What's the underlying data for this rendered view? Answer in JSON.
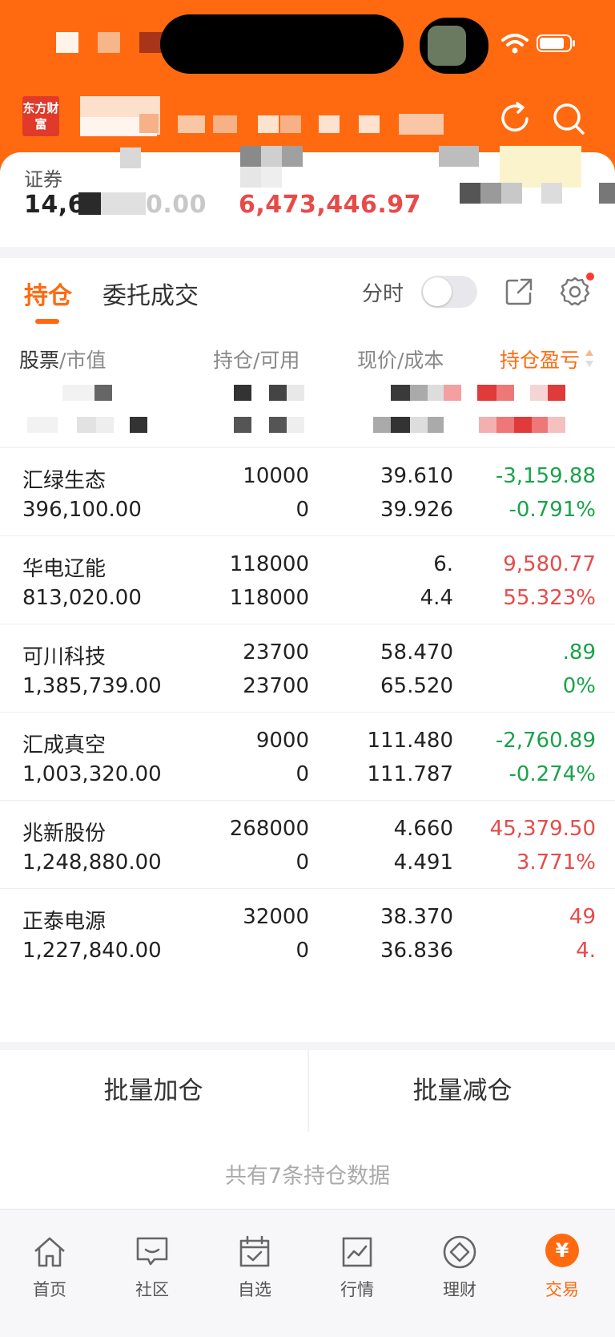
{
  "header": {
    "brand_logo_text": "东方财富",
    "colors": {
      "brand": "#ff6a10",
      "up": "#e84a4a",
      "down": "#1aa34a"
    }
  },
  "account": {
    "label": "证券",
    "total_assets": "14,6",
    "total_assets_tail": "0.00",
    "profit": "6,473,446.97"
  },
  "tabs": {
    "positions": "持仓",
    "orders": "委托成交"
  },
  "controls": {
    "time_share": "分时"
  },
  "columns": {
    "stock": "股票",
    "market_value": "/市值",
    "position_available": "持仓/可用",
    "price_cost": "现价/成本",
    "pnl": "持仓盈亏"
  },
  "holdings": [
    {
      "name": "汇绿生态",
      "market_value": "396,100.00",
      "qty": "10000",
      "available": "0",
      "price": "39.610",
      "cost": "39.926",
      "pnl": "-3,159.88",
      "pnl_pct": "-0.791%",
      "dir": "down"
    },
    {
      "name": "华电辽能",
      "market_value": "813,020.00",
      "qty": "118000",
      "available": "118000",
      "price": "6.",
      "cost": "4.4",
      "pnl": "9,580.77",
      "pnl_pct": "55.323%",
      "dir": "up"
    },
    {
      "name": "可川科技",
      "market_value": "1,385,739.00",
      "qty": "23700",
      "available": "23700",
      "price": "58.470",
      "cost": "65.520",
      "pnl": ".89",
      "pnl_pct": "0%",
      "dir": "down"
    },
    {
      "name": "汇成真空",
      "market_value": "1,003,320.00",
      "qty": "9000",
      "available": "0",
      "price": "111.480",
      "cost": "111.787",
      "pnl": "-2,760.89",
      "pnl_pct": "-0.274%",
      "dir": "down"
    },
    {
      "name": "兆新股份",
      "market_value": "1,248,880.00",
      "qty": "268000",
      "available": "0",
      "price": "4.660",
      "cost": "4.491",
      "pnl": "45,379.50",
      "pnl_pct": "3.771%",
      "dir": "up"
    },
    {
      "name": "正泰电源",
      "market_value": "1,227,840.00",
      "qty": "32000",
      "available": "0",
      "price": "38.370",
      "cost": "36.836",
      "pnl": "49",
      "pnl_pct": "4.",
      "dir": "up"
    }
  ],
  "batch": {
    "add": "批量加仓",
    "reduce": "批量减仓"
  },
  "footer_note": "共有7条持仓数据",
  "nav": [
    {
      "label": "首页",
      "icon": "home-icon"
    },
    {
      "label": "社区",
      "icon": "community-icon"
    },
    {
      "label": "自选",
      "icon": "watchlist-icon"
    },
    {
      "label": "行情",
      "icon": "market-icon"
    },
    {
      "label": "理财",
      "icon": "wealth-icon"
    },
    {
      "label": "交易",
      "icon": "trade-icon",
      "glyph": "¥"
    }
  ]
}
